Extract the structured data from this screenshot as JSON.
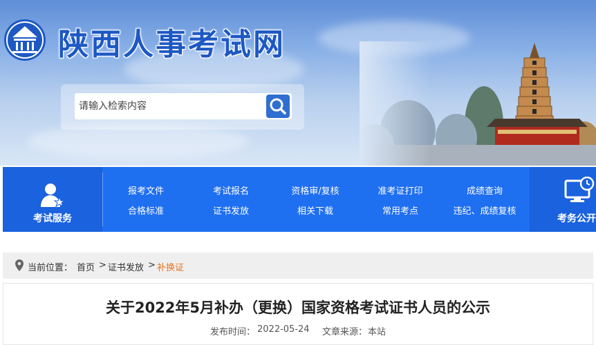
{
  "header": {
    "site_title": "陕西人事考试网",
    "logo_icon": "gov-building-logo-icon",
    "brand_color": "#1d58c4"
  },
  "search": {
    "placeholder": "请输入检索内容",
    "button_icon": "search-icon"
  },
  "nav": {
    "left_label": "考试服务",
    "left_icon": "user-star-icon",
    "items": [
      {
        "label": "报考文件"
      },
      {
        "label": "合格标准"
      },
      {
        "label": "考试报名"
      },
      {
        "label": "证书发放"
      },
      {
        "label": "资格审/复核"
      },
      {
        "label": "相关下载"
      },
      {
        "label": "准考证打印"
      },
      {
        "label": "常用考点"
      },
      {
        "label": "成绩查询"
      },
      {
        "label": "违纪、成绩复核"
      }
    ],
    "right_label": "考务公开",
    "right_icon": "monitor-clock-icon",
    "accent_color": "#1f6ff1"
  },
  "breadcrumb": {
    "prefix": "当前位置：",
    "items": [
      "首页",
      "证书发放",
      "补换证"
    ],
    "separator": ">",
    "location_icon": "location-pin-icon"
  },
  "article": {
    "title": "关于2022年5月补办（更换）国家资格考试证书人员的公示",
    "publish_label": "发布时间：",
    "publish_date": "2022-05-24",
    "source_label": "文章来源：",
    "source": "本站"
  }
}
